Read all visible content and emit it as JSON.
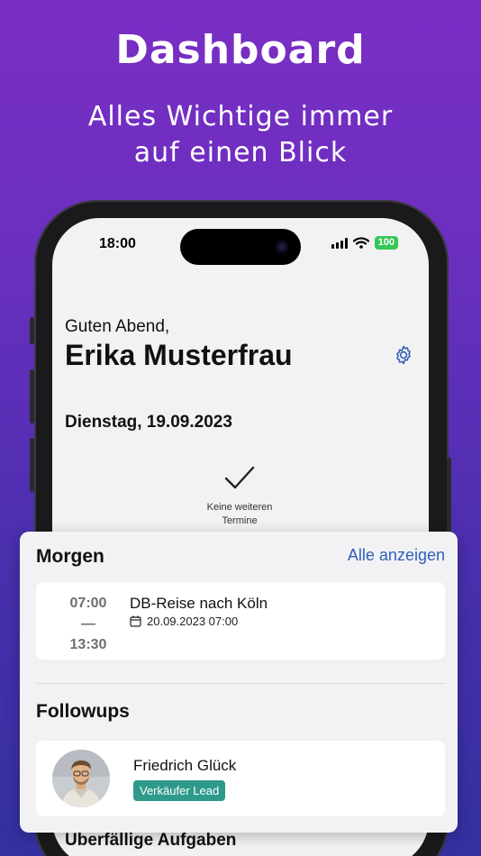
{
  "promo": {
    "title": "Dashboard",
    "subtitle_line1": "Alles Wichtige immer",
    "subtitle_line2": "auf einen Blick"
  },
  "status_bar": {
    "time": "18:00",
    "battery": "100"
  },
  "header": {
    "greeting": "Guten Abend,",
    "user_name": "Erika Musterfrau",
    "settings_icon": "gear-icon"
  },
  "today": {
    "date_label": "Dienstag, 19.09.2023",
    "empty_line1": "Keine weiteren",
    "empty_line2": "Termine"
  },
  "tomorrow": {
    "title": "Morgen",
    "show_all": "Alle anzeigen",
    "appointments": [
      {
        "start": "07:00",
        "separator": "—",
        "end": "13:30",
        "title": "DB-Reise nach Köln",
        "date": "20.09.2023 07:00",
        "icon": "calendar-icon"
      }
    ]
  },
  "followups": {
    "title": "Followups",
    "items": [
      {
        "name": "Friedrich Glück",
        "role": "Verkäufer Lead",
        "avatar": "avatar-photo"
      }
    ]
  },
  "overdue": {
    "title": "Überfällige Aufgaben"
  },
  "colors": {
    "accent": "#2f5fb8",
    "badge": "#2e9a8a",
    "battery": "#34c759",
    "background_top": "#7a2ec4",
    "background_bottom": "#33309f"
  }
}
